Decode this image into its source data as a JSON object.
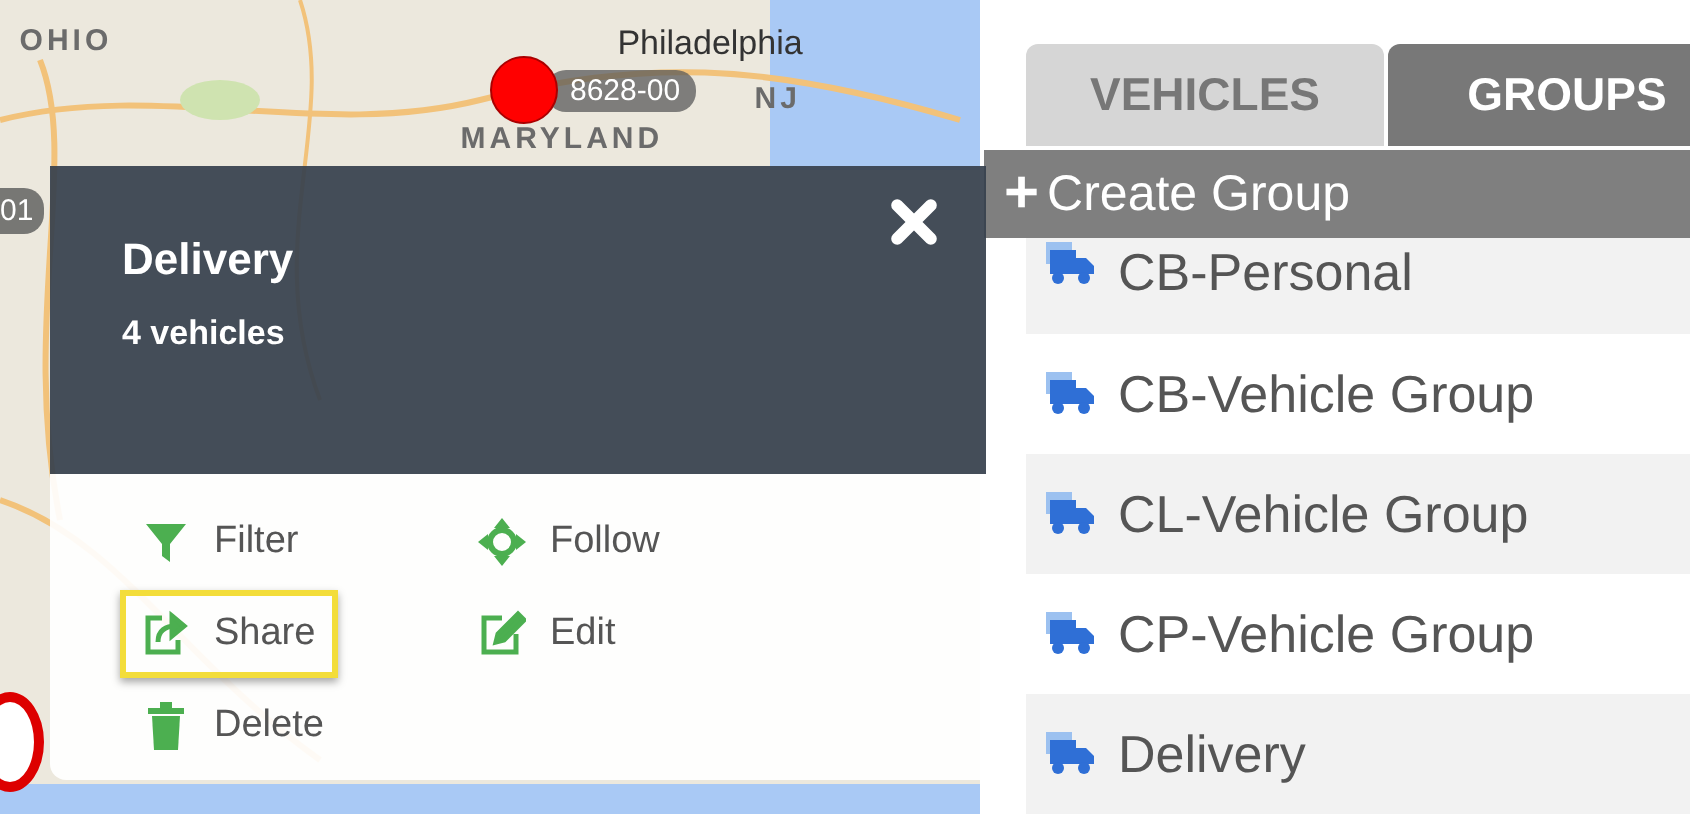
{
  "map": {
    "labels": [
      {
        "text": "OHIO",
        "kind": "region"
      },
      {
        "text": "Philadelphia",
        "kind": "city"
      },
      {
        "text": "NJ",
        "kind": "region"
      },
      {
        "text": "MARYLAND",
        "kind": "region"
      }
    ],
    "markers": [
      {
        "label": "8628-00",
        "kind": "dot"
      },
      {
        "label": "01",
        "kind": "badge"
      },
      {
        "kind": "ring"
      }
    ]
  },
  "popup": {
    "title": "Delivery",
    "subtitle": "4 vehicles",
    "actions": [
      {
        "label": "Filter",
        "kind": "filter",
        "highlighted": false
      },
      {
        "label": "Follow",
        "kind": "follow",
        "highlighted": false
      },
      {
        "label": "Share",
        "kind": "share",
        "highlighted": true
      },
      {
        "label": "Edit",
        "kind": "edit",
        "highlighted": false
      },
      {
        "label": "Delete",
        "kind": "delete",
        "highlighted": false
      }
    ]
  },
  "tabs": [
    {
      "label": "VEHICLES",
      "selected": false
    },
    {
      "label": "GROUPS",
      "selected": true
    }
  ],
  "create_group": {
    "icon": "+",
    "label": "Create Group"
  },
  "groups": [
    {
      "name": "CB-Personal"
    },
    {
      "name": "CB-Vehicle Group"
    },
    {
      "name": "CL-Vehicle Group"
    },
    {
      "name": "CP-Vehicle Group"
    },
    {
      "name": "Delivery"
    }
  ]
}
